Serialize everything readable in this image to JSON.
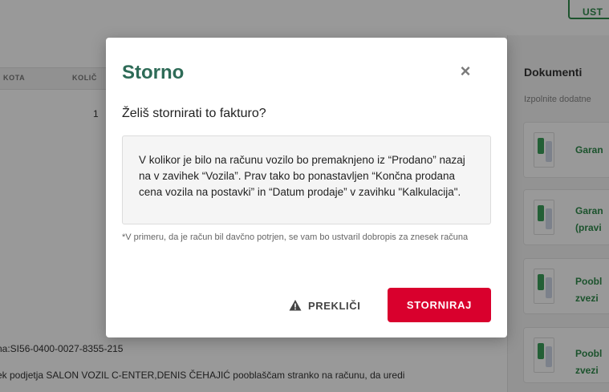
{
  "background": {
    "top_button": "UST",
    "table": {
      "col1": "KOTA",
      "col2": "KOLIČ",
      "qty": "1"
    },
    "documents": {
      "title": "Dokumenti",
      "subtitle": "Izpolnite dodatne",
      "cards": [
        {
          "line1": "Garan",
          "line2": ""
        },
        {
          "line1": "Garan",
          "line2": "(pravi"
        },
        {
          "line1": "Poobl",
          "line2": "zvezi"
        },
        {
          "line1": "Poobl",
          "line2": "zvezi"
        }
      ]
    },
    "line1": "na:SI56-0400-0027-8355-215",
    "line2": "ek podjetja SALON VOZIL C-ENTER,DENIS ČEHAJIĆ pooblaščam stranko na računu, da uredi"
  },
  "modal": {
    "title": "Storno",
    "close_icon": "×",
    "question": "Želiš stornirati to fakturo?",
    "info": "V kolikor je bilo na računu vozilo bo premaknjeno iz “Prodano” nazaj na v zavihek “Vozila”. Prav tako bo ponastavljen “Končna prodana cena vozila na postavki” in “Datum prodaje” v zavihku \"Kalkulacija\".",
    "note": "*V primeru, da je račun bil davčno potrjen, se vam bo ustvaril dobropis za znesek računa",
    "cancel_label": "PREKLIČI",
    "confirm_label": "STORNIRAJ",
    "colors": {
      "title": "#2e6b57",
      "confirm": "#d9002d"
    }
  }
}
